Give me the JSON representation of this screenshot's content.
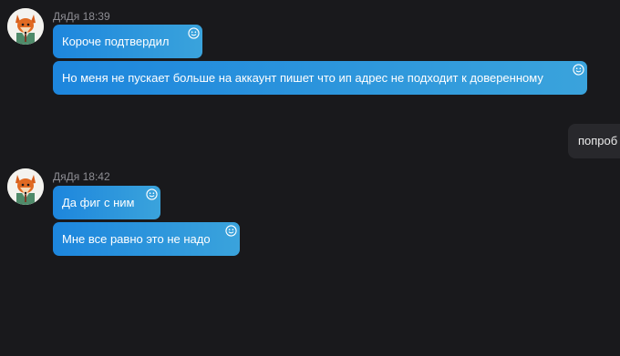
{
  "messages": [
    {
      "author": "ДяДя",
      "time": "18:39",
      "avatar_icon": "fox-avatar-icon",
      "bubbles": [
        "Короче подтвердил",
        "Но меня не пускает больше на аккаунт пишет что ип адрес не подходит к доверенному"
      ]
    },
    {
      "outgoing": true,
      "bubbles": [
        "попроб"
      ]
    },
    {
      "author": "ДяДя",
      "time": "18:42",
      "avatar_icon": "fox-avatar-icon",
      "bubbles": [
        "Да фиг с ним",
        "Мне все равно это не надо"
      ]
    }
  ],
  "icons": {
    "reaction": "smiley-reaction-icon"
  },
  "colors": {
    "background": "#19191c",
    "incoming_bubble_start": "#1d86dd",
    "incoming_bubble_end": "#3aa3dc",
    "outgoing_bubble": "#28282c",
    "meta_text": "#8d8d93"
  }
}
